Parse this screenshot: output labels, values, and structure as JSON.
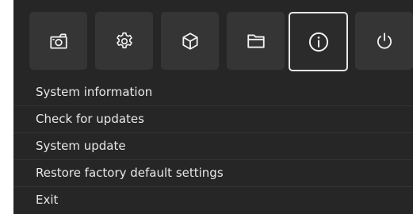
{
  "toolbar": {
    "icons": [
      {
        "name": "camera-icon",
        "selected": false
      },
      {
        "name": "gear-icon",
        "selected": false
      },
      {
        "name": "cube-icon",
        "selected": false
      },
      {
        "name": "folder-icon",
        "selected": false
      },
      {
        "name": "info-icon",
        "selected": true
      },
      {
        "name": "power-icon",
        "selected": false
      }
    ]
  },
  "menu": {
    "items": [
      {
        "label": "System information"
      },
      {
        "label": "Check for updates"
      },
      {
        "label": "System update"
      },
      {
        "label": "Restore factory default settings"
      },
      {
        "label": "Exit"
      }
    ]
  },
  "colors": {
    "background": "#262626",
    "tile": "#353535",
    "selected_border": "#e6e6e6",
    "text": "#e8e8e8"
  }
}
